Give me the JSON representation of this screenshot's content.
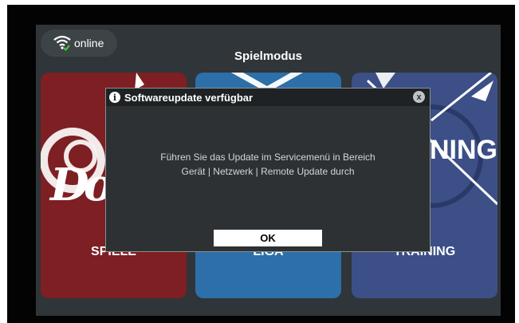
{
  "status": {
    "label": "online",
    "icon": "wifi-connected-icon"
  },
  "mode_title": "Spielmodus",
  "cards": [
    {
      "label": "SPIELE",
      "color": "#7d1f23"
    },
    {
      "label": "LIGA",
      "color": "#2d6fa8"
    },
    {
      "label": "TRAINING",
      "color": "#3c4f86"
    }
  ],
  "card_art": {
    "spiele_text": "D",
    "training_text": "NING"
  },
  "dialog": {
    "title": "Softwareupdate verfügbar",
    "message_line1": "Führen Sie das Update im Servicemenü in Bereich",
    "message_line2": "Gerät | Netzwerk | Remote Update durch",
    "ok_label": "OK",
    "info_icon": "info-icon",
    "close_icon": "close-icon"
  }
}
